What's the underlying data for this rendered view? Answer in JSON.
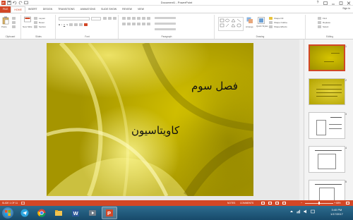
{
  "window": {
    "title": "Document1 - PowerPoint",
    "signin": "Sign in"
  },
  "tabs": [
    "FILE",
    "HOME",
    "INSERT",
    "DESIGN",
    "TRANSITIONS",
    "ANIMATIONS",
    "SLIDE SHOW",
    "REVIEW",
    "VIEW"
  ],
  "active_tab": "HOME",
  "ribbon": {
    "groups": [
      "Clipboard",
      "Slides",
      "Font",
      "Paragraph",
      "Drawing",
      "Editing"
    ],
    "paste_label": "Paste",
    "new_slide_label": "New Slide",
    "layout_label": "Layout",
    "reset_label": "Reset",
    "section_label": "Section",
    "arrange_label": "Arrange",
    "quick_styles_label": "Quick Styles",
    "shape_fill_label": "Shape Fill",
    "shape_outline_label": "Shape Outline",
    "shape_effects_label": "Shape Effects",
    "find_label": "Find",
    "replace_label": "Replace",
    "select_label": "Select"
  },
  "slide": {
    "title": "فصل سوم",
    "subtitle": "کاویتاسیون"
  },
  "thumbnails": [
    {
      "number": "1",
      "active": true
    },
    {
      "number": "2",
      "active": false
    },
    {
      "number": "3",
      "active": false
    },
    {
      "number": "4",
      "active": false
    },
    {
      "number": "5",
      "active": false
    }
  ],
  "statusbar": {
    "slide_indicator": "SLIDE 1 OF 11",
    "notes_label": "NOTES",
    "comments_label": "COMMENTS",
    "zoom_level": "68%"
  },
  "taskbar": {
    "time": "3:40 PM",
    "date": "1/17/2017"
  },
  "colors": {
    "accent": "#d24726",
    "slide_yellow": "#c9b800",
    "taskbar": "#1f5a7e"
  }
}
